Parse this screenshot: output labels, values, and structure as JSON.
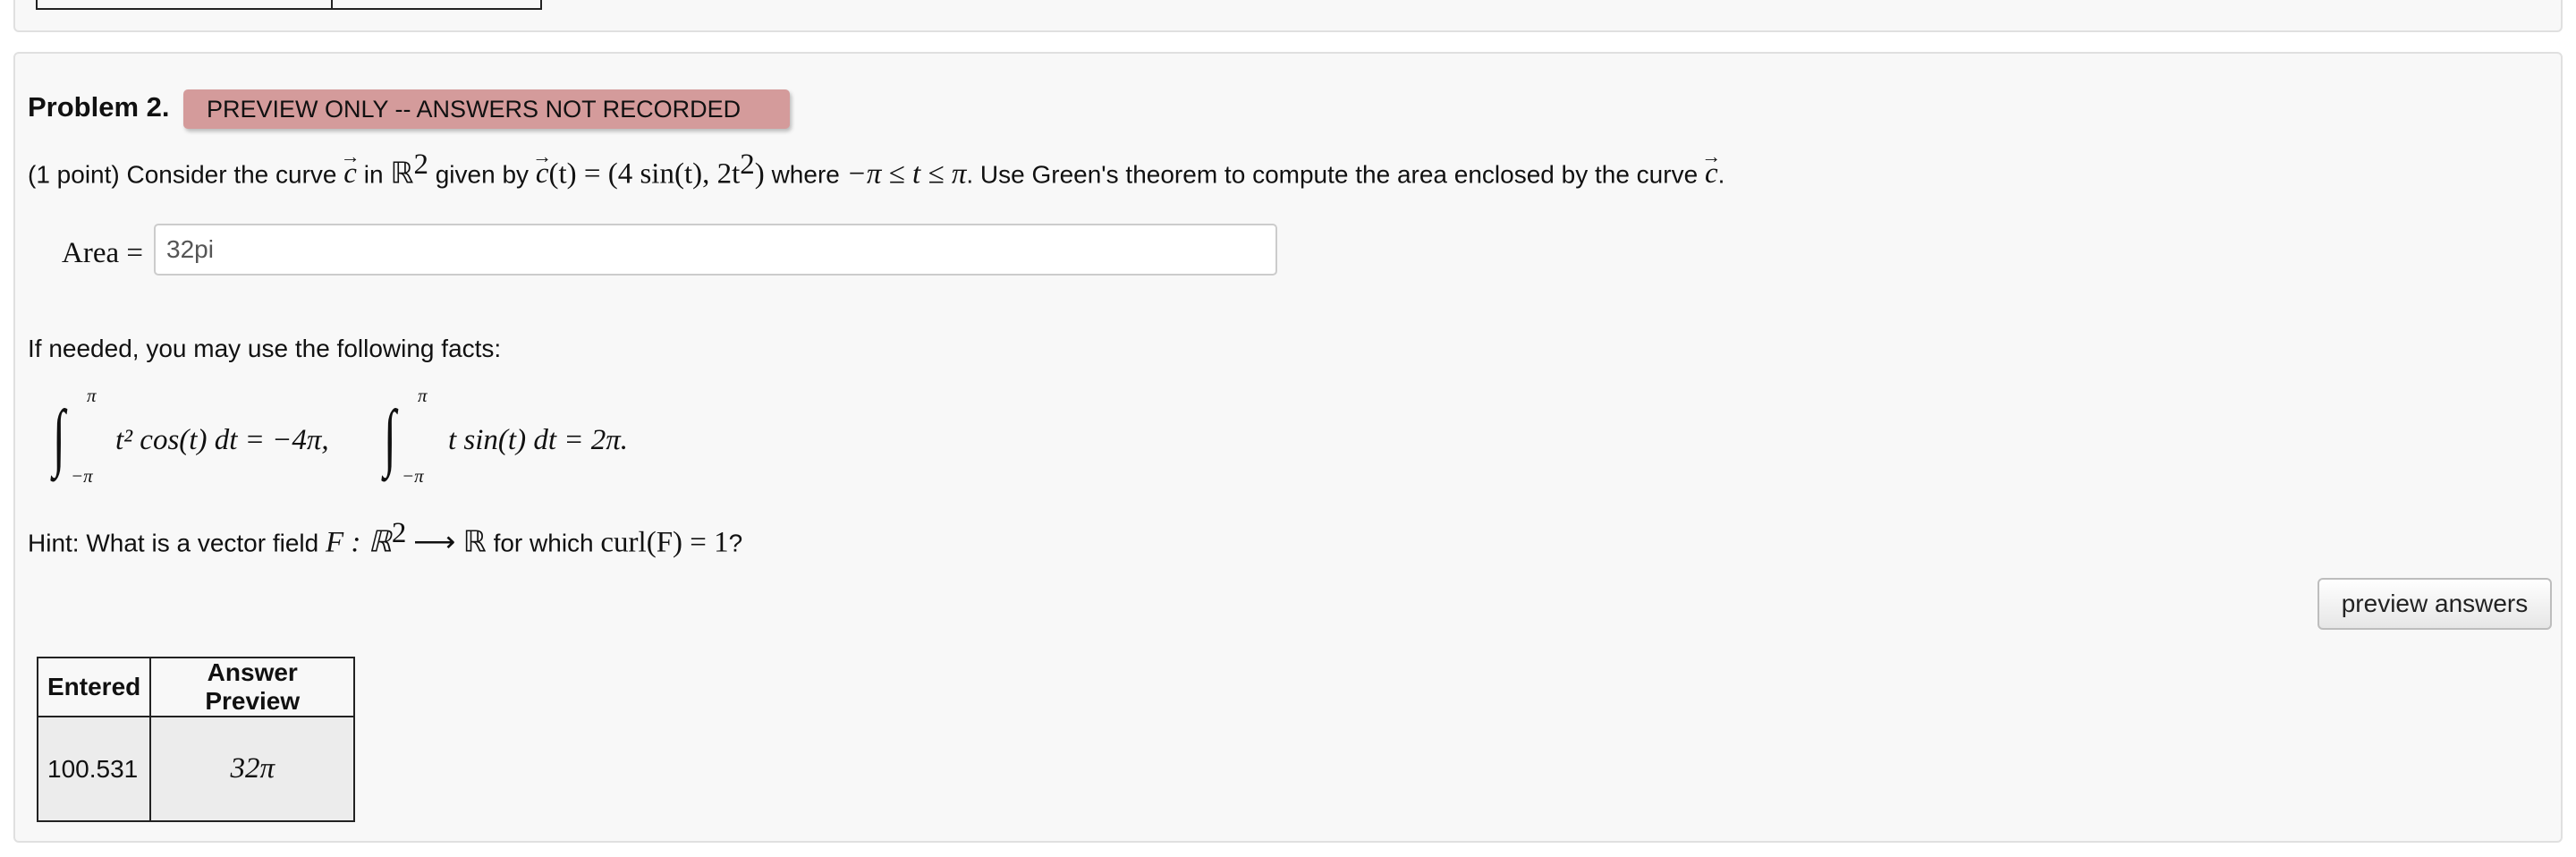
{
  "previous_problem": {},
  "problem": {
    "title": "Problem 2.",
    "badge": "PREVIEW ONLY -- ANSWERS NOT RECORDED",
    "statement": {
      "intro": "(1 point) Consider the curve",
      "c": "c",
      "in": "in",
      "R": "ℝ",
      "R_exp": "2",
      "given_by": "given by",
      "param_c": "c",
      "param_rest": "(t) = (4 sin(t),  2t",
      "param_exp": "2",
      "param_close": ")",
      "where": "where",
      "range": "−π ≤ t ≤ π",
      "tail": ". Use Green's theorem to compute the area enclosed by the curve",
      "c_end": "c",
      "period": "."
    },
    "area": {
      "label": "Area =",
      "value": "32pi"
    },
    "facts_intro": "If needed, you may use the following facts:",
    "facts": [
      {
        "upper": "π",
        "lower": "−π",
        "body": "t² cos(t) dt = −4π,"
      },
      {
        "upper": "π",
        "lower": "−π",
        "body": "t sin(t) dt = 2π."
      }
    ],
    "hint": {
      "prefix": "Hint: What is a vector field",
      "math": "F : ℝ",
      "exp": "2",
      "arrow": "⟶ ℝ",
      "mid": "for which",
      "curl": "curl(F) = 1",
      "q": "?"
    },
    "preview_button": "preview answers",
    "answers_table": {
      "headers": [
        "Entered",
        "Answer Preview"
      ],
      "rows": [
        {
          "entered": "100.531",
          "preview": "32π"
        }
      ]
    }
  }
}
